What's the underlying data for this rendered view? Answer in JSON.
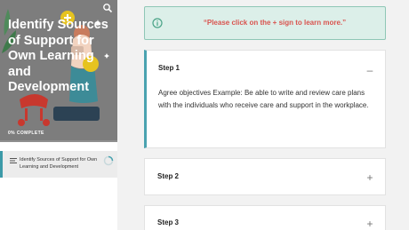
{
  "sidebar": {
    "hero": {
      "title": "Identify Sources of Support for Own Learning and Development",
      "progress_label": "0% COMPLETE",
      "progress_fraction": 0.0
    },
    "lessons": [
      {
        "label": "Identify Sources of Support for Own Learning and Development",
        "progress_fraction": 0.0
      }
    ]
  },
  "main": {
    "callout": {
      "text": "“Please click on the + sign to learn more.”",
      "icon": "info-icon"
    },
    "accordion": [
      {
        "title": "Step 1",
        "toggle": "–",
        "expanded": true,
        "body": "Agree objectives Example: Be able to write and review care plans with the individuals who receive care and support in the workplace."
      },
      {
        "title": "Step 2",
        "toggle": "+",
        "expanded": false
      },
      {
        "title": "Step 3",
        "toggle": "+",
        "expanded": false
      }
    ]
  },
  "colors": {
    "accent": "#4aa3b0",
    "callout_bg": "#dcefe9",
    "callout_text": "#d9544f",
    "hero_bg": "#7b7b7b"
  }
}
